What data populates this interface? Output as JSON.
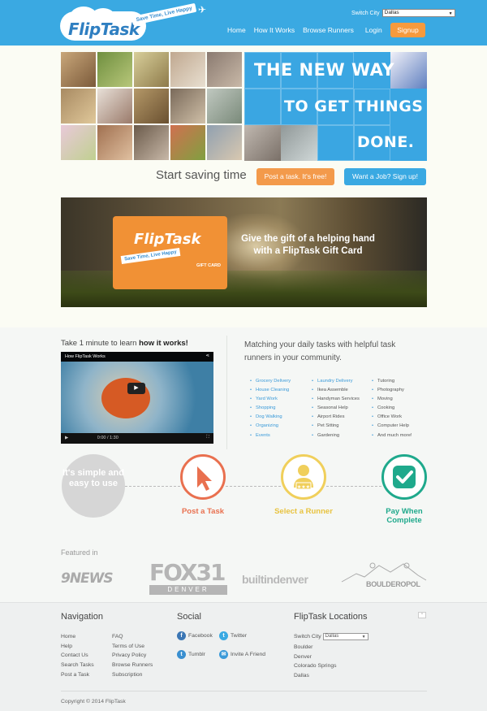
{
  "header": {
    "logo_text": "FlipTask",
    "tagline": "Save Time, Live Happy",
    "switch_city_label": "Switch City",
    "city_selected": "Dallas",
    "nav": [
      "Home",
      "How It Works",
      "Browse Runners",
      "Login"
    ],
    "signup_label": "Signup"
  },
  "hero": {
    "line1": "THE NEW WAY",
    "line2": "TO GET THINGS",
    "line3": "DONE."
  },
  "cta": {
    "text": "Start saving time",
    "post_task": "Post a task. It's free!",
    "want_job": "Want a Job? Sign up!"
  },
  "gift": {
    "logo_text": "FlipTask",
    "tagline": "Save Time, Live Happy",
    "card_label": "GIFT CARD",
    "message": "Give the gift of a helping hand with a FlipTask Gift Card"
  },
  "learn": {
    "prefix": "Take 1 minute to learn ",
    "bold": "how it works!",
    "video_title": "How FlipTask Works",
    "video_time": "0:00 / 1:30"
  },
  "match_text": "Matching your daily tasks with helpful task runners in your community.",
  "tasks": {
    "col1": [
      "Grocery Delivery",
      "House Cleaning",
      "Yard Work",
      "Shopping",
      "Dog Walking",
      "Organizing",
      "Events"
    ],
    "col2": [
      "Laundry Delivery",
      "Ikea Assemble",
      "Handyman Services",
      "Seasonal Help",
      "Airport Rides",
      "Pet Sitting",
      "Gardening"
    ],
    "col3": [
      "Tutoring",
      "Photography",
      "Moving",
      "Cooking",
      "Office Work",
      "Computer Help",
      "And much more!"
    ]
  },
  "steps": {
    "simple": "It's simple and easy to use",
    "post": "Post a Task",
    "select": "Select a Runner",
    "pay": "Pay When Complete"
  },
  "colors": {
    "post": "#e9704f",
    "select": "#f0cf5b",
    "pay": "#1fa98c",
    "header": "#3aa9e2",
    "signup": "#f69a3d"
  },
  "featured": {
    "title": "Featured in",
    "logos": [
      "9NEWS",
      "FOX31",
      "DENVER",
      "builtindenver",
      "BOULDEROPOL"
    ]
  },
  "footer": {
    "nav_title": "Navigation",
    "nav_col1": [
      "Home",
      "Help",
      "Contact Us",
      "Search Tasks",
      "Post a Task"
    ],
    "nav_col2": [
      "FAQ",
      "Terms of Use",
      "Privacy Policy",
      "Browse Runners",
      "Subscription"
    ],
    "social_title": "Social",
    "social": [
      "Facebook",
      "Twitter",
      "Tumblr",
      "Invite A Friend"
    ],
    "locations_title": "FlipTask Locations",
    "switch_city_label": "Switch City",
    "city_selected": "Dallas",
    "locations": [
      "Boulder",
      "Denver",
      "Colorado Springs",
      "Dallas"
    ],
    "copyright": "Copyright © 2014 FlipTask"
  }
}
